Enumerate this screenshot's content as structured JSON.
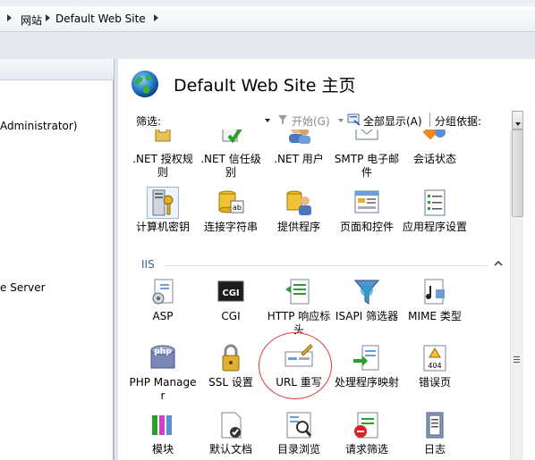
{
  "window": {
    "title_partial": ""
  },
  "breadcrumb": {
    "items": [
      "网站",
      "Default Web Site"
    ]
  },
  "connections": {
    "tree": [
      {
        "text": "Administrator)"
      },
      {
        "text": "e Server"
      }
    ]
  },
  "page": {
    "title": "Default Web Site 主页"
  },
  "filter": {
    "label": "筛选:",
    "start_label": "开始(G)",
    "show_all_label": "全部显示(A)",
    "group_by_label": "分组依据:"
  },
  "rows": {
    "aspnet_partial": [
      {
        "label": ".NET 授权规则",
        "icon": "net-authorization-icon"
      },
      {
        "label": ".NET 信任级别",
        "icon": "net-trust-icon"
      },
      {
        "label": ".NET 用户",
        "icon": "net-users-icon"
      },
      {
        "label": "SMTP 电子邮件",
        "icon": "smtp-email-icon"
      },
      {
        "label": "会话状态",
        "icon": "session-state-icon"
      }
    ],
    "aspnet_second": [
      {
        "label": "计算机密钥",
        "icon": "machine-key-icon"
      },
      {
        "label": "连接字符串",
        "icon": "connection-strings-icon"
      },
      {
        "label": "提供程序",
        "icon": "providers-icon"
      },
      {
        "label": "页面和控件",
        "icon": "pages-controls-icon"
      },
      {
        "label": "应用程序设置",
        "icon": "app-settings-icon"
      }
    ]
  },
  "iis_section": {
    "header": "IIS",
    "items_row1": [
      {
        "label": "ASP",
        "icon": "asp-icon"
      },
      {
        "label": "CGI",
        "icon": "cgi-icon"
      },
      {
        "label": "HTTP 响应标头",
        "icon": "http-response-headers-icon"
      },
      {
        "label": "ISAPI 筛选器",
        "icon": "isapi-filters-icon"
      },
      {
        "label": "MIME 类型",
        "icon": "mime-types-icon"
      }
    ],
    "items_row2": [
      {
        "label": "PHP Manager",
        "icon": "php-manager-icon"
      },
      {
        "label": "SSL 设置",
        "icon": "ssl-settings-icon"
      },
      {
        "label": "URL 重写",
        "icon": "url-rewrite-icon"
      },
      {
        "label": "处理程序映射",
        "icon": "handler-mappings-icon"
      },
      {
        "label": "错误页",
        "icon": "error-pages-icon"
      }
    ],
    "items_row3": [
      {
        "label": "模块",
        "icon": "modules-icon"
      },
      {
        "label": "默认文档",
        "icon": "default-document-icon"
      },
      {
        "label": "目录浏览",
        "icon": "directory-browsing-icon"
      },
      {
        "label": "请求筛选",
        "icon": "request-filtering-icon"
      },
      {
        "label": "日志",
        "icon": "logging-icon"
      }
    ],
    "error_page_code": "404",
    "cgi_text": "CGI",
    "php_text": "php"
  },
  "colors": {
    "accent": "#3a5f96",
    "highlight_ellipse": "#e23c3c"
  }
}
